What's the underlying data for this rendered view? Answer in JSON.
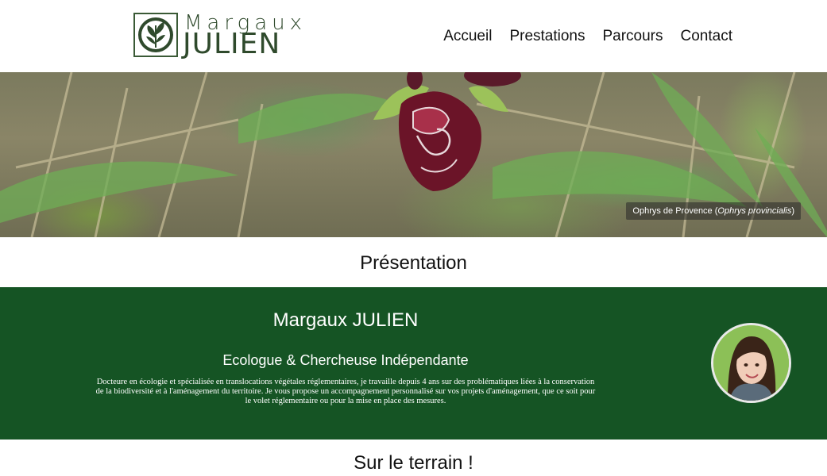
{
  "header": {
    "logo": {
      "first_name": "Margaux",
      "last_name": "JULIEN",
      "emblem_icon": "botanical-emblem-icon"
    },
    "nav": [
      {
        "label": "Accueil"
      },
      {
        "label": "Prestations"
      },
      {
        "label": "Parcours"
      },
      {
        "label": "Contact"
      }
    ]
  },
  "hero": {
    "caption_common": "Ophrys de Provence (",
    "caption_latin": "Ophrys provincialis",
    "caption_end": ")"
  },
  "presentation": {
    "title": "Présentation"
  },
  "profile": {
    "name": "Margaux JULIEN",
    "subtitle": "Ecologue & Chercheuse Indépendante",
    "description": "Docteure en écologie et spécialisée en translocations végétales réglementaires, je travaille depuis 4 ans sur des problématiques liées à la conservation de la biodiversité et à l'aménagement du territoire. Je vous propose un accompagnement personnalisé sur vos projets d'aménagement, que ce soit pour le volet réglementaire ou pour la mise en place des mesures."
  },
  "terrain": {
    "title": "Sur le terrain !"
  },
  "colors": {
    "band_green": "#155424",
    "logo_green": "#2f4a2c"
  }
}
